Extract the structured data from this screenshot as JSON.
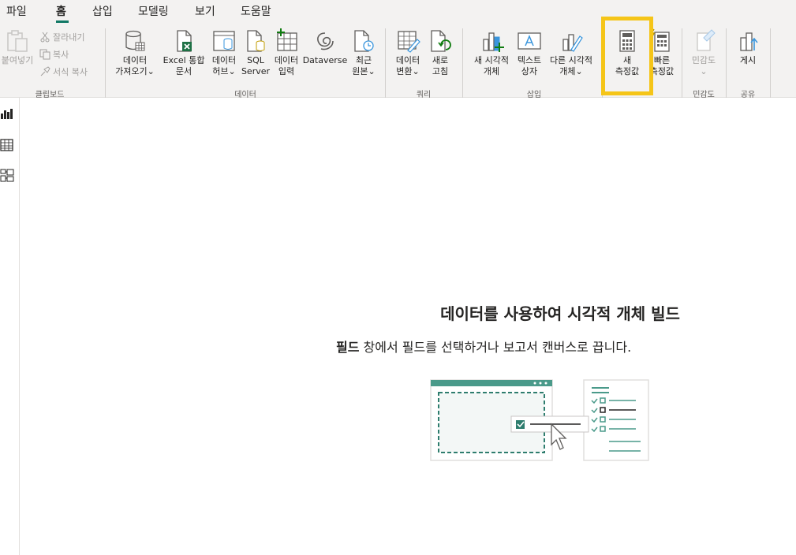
{
  "menu": {
    "tabs": [
      "파일",
      "홈",
      "삽입",
      "모델링",
      "보기",
      "도움말"
    ],
    "active": "홈"
  },
  "ribbon": {
    "clipboard": {
      "label": "클립보드",
      "paste": "붙여넣기",
      "cut": "잘라내기",
      "copy": "복사",
      "format_painter": "서식 복사"
    },
    "data": {
      "label": "데이터",
      "get_data": [
        "데이터",
        "가져오기⌄"
      ],
      "excel": [
        "Excel 통합",
        "문서"
      ],
      "data_hub": [
        "데이터",
        "허브⌄"
      ],
      "sql": [
        "SQL",
        "Server"
      ],
      "enter_data": [
        "데이터",
        "입력"
      ],
      "dataverse": [
        "Dataverse"
      ],
      "recent": [
        "최근",
        "원본⌄"
      ]
    },
    "queries": {
      "label": "쿼리",
      "transform": [
        "데이터",
        "변환⌄"
      ],
      "refresh": [
        "새로",
        "고침"
      ]
    },
    "insert": {
      "label": "삽입",
      "new_visual": [
        "새 시각적",
        "개체"
      ],
      "text_box": [
        "텍스트",
        "상자"
      ],
      "more_visuals": [
        "다른 시각적",
        "개체⌄"
      ]
    },
    "calculations": {
      "new_measure": [
        "새",
        "측정값"
      ],
      "quick_measure": [
        "빠른",
        "측정값"
      ]
    },
    "sensitivity": {
      "label": "민감도",
      "button": [
        "민감도",
        "⌄"
      ]
    },
    "share": {
      "label": "공유",
      "publish": [
        "게시"
      ]
    }
  },
  "canvas": {
    "title": "데이터를 사용하여 시각적 개체 빌드",
    "subtitle_bold": "필드",
    "subtitle_rest": " 창에서 필드를 선택하거나 보고서 캔버스로 끕니다."
  },
  "colors": {
    "accent": "#117865",
    "highlight": "#f5c518",
    "illustration": "#4a9a8a"
  }
}
